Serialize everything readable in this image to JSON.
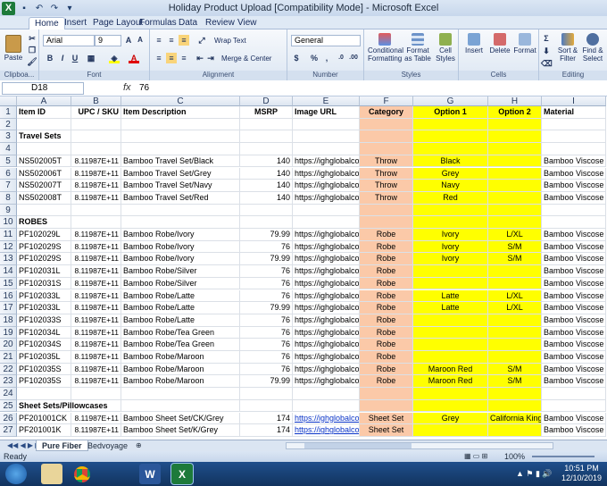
{
  "window": {
    "title": "Holiday Product Upload  [Compatibility Mode] - Microsoft Excel"
  },
  "tabs": [
    "Home",
    "Insert",
    "Page Layout",
    "Formulas",
    "Data",
    "Review",
    "View"
  ],
  "ribbon": {
    "paste": "Paste",
    "clipboard": "Clipboa...",
    "font_name": "Arial",
    "font_size": "9",
    "font_group": "Font",
    "wrap_text": "Wrap Text",
    "merge_center": "Merge & Center",
    "alignment_group": "Alignment",
    "number_format": "General",
    "number_group": "Number",
    "percent": "%",
    "comma": ",",
    "currency": "$",
    "cond_fmt": "Conditional Formatting",
    "fmt_table": "Format as Table",
    "cell_styles": "Cell Styles",
    "styles_group": "Styles",
    "insert": "Insert",
    "delete": "Delete",
    "format": "Format",
    "cells_group": "Cells",
    "sort_filter": "Sort & Filter",
    "find_select": "Find & Select",
    "editing_group": "Editing"
  },
  "formula_bar": {
    "name_box": "D18",
    "fx": "fx",
    "value": "76"
  },
  "columns": [
    "A",
    "B",
    "C",
    "D",
    "E",
    "F",
    "G",
    "H",
    "I"
  ],
  "rows": [
    {
      "n": "1",
      "A": "Item ID",
      "B": "UPC / SKU",
      "C": "Item Description",
      "D": "MSRP",
      "E": "Image URL",
      "F": "Category",
      "G": "Option 1",
      "H": "Option 2",
      "I": "Material",
      "hdr": true
    },
    {
      "n": "2"
    },
    {
      "n": "3",
      "A": "Travel Sets",
      "section": true
    },
    {
      "n": "4"
    },
    {
      "n": "5",
      "A": "NS502005T",
      "B": "8.11987E+11",
      "C": "Bamboo Travel Set/Black",
      "D": "140",
      "E": "https://ighglobalcorp.c",
      "F": "Throw",
      "G": "Black",
      "I": "Bamboo Viscose"
    },
    {
      "n": "6",
      "A": "NS502006T",
      "B": "8.11987E+11",
      "C": "Bamboo Travel Set/Grey",
      "D": "140",
      "E": "https://ighglobalcorp.c",
      "F": "Throw",
      "G": "Grey",
      "I": "Bamboo Viscose"
    },
    {
      "n": "7",
      "A": "NS502007T",
      "B": "8.11987E+11",
      "C": "Bamboo Travel Set/Navy",
      "D": "140",
      "E": "https://ighglobalcorp.c",
      "F": "Throw",
      "G": "Navy",
      "I": "Bamboo Viscose"
    },
    {
      "n": "8",
      "A": "NS502008T",
      "B": "8.11987E+11",
      "C": "Bamboo Travel Set/Red",
      "D": "140",
      "E": "https://ighglobalcorp.c",
      "F": "Throw",
      "G": "Red",
      "I": "Bamboo Viscose"
    },
    {
      "n": "9"
    },
    {
      "n": "10",
      "A": "ROBES",
      "section": true
    },
    {
      "n": "11",
      "A": "PF102029L",
      "B": "8.11987E+11",
      "C": "Bamboo Robe/Ivory",
      "D": "79.99",
      "E": "https://ighglobalcorp.c",
      "F": "Robe",
      "G": "Ivory",
      "H": "L/XL",
      "I": "Bamboo Viscose"
    },
    {
      "n": "12",
      "A": "PF102029S",
      "B": "8.11987E+11",
      "C": "Bamboo Robe/Ivory",
      "D": "76",
      "E": "https://ighglobalcorp.c",
      "F": "Robe",
      "G": "Ivory",
      "H": "S/M",
      "I": "Bamboo Viscose"
    },
    {
      "n": "13",
      "A": "PF102029S",
      "B": "8.11987E+11",
      "C": "Bamboo Robe/Ivory",
      "D": "79.99",
      "E": "https://ighglobalcorp.c",
      "F": "Robe",
      "G": "Ivory",
      "H": "S/M",
      "I": "Bamboo Viscose"
    },
    {
      "n": "14",
      "A": "PF102031L",
      "B": "8.11987E+11",
      "C": "Bamboo Robe/Silver",
      "D": "76",
      "E": "https://ighglobalcorp.c",
      "F": "Robe",
      "I": "Bamboo Viscose"
    },
    {
      "n": "15",
      "A": "PF102031S",
      "B": "8.11987E+11",
      "C": "Bamboo Robe/Silver",
      "D": "76",
      "E": "https://ighglobalcorp.c",
      "F": "Robe",
      "I": "Bamboo Viscose"
    },
    {
      "n": "16",
      "A": "PF102033L",
      "B": "8.11987E+11",
      "C": "Bamboo Robe/Latte",
      "D": "76",
      "E": "https://ighglobalcorp.c",
      "F": "Robe",
      "G": "Latte",
      "H": "L/XL",
      "I": "Bamboo Viscose"
    },
    {
      "n": "17",
      "A": "PF102033L",
      "B": "8.11987E+11",
      "C": "Bamboo Robe/Latte",
      "D": "79.99",
      "E": "https://ighglobalcorp.c",
      "F": "Robe",
      "G": "Latte",
      "H": "L/XL",
      "I": "Bamboo Viscose"
    },
    {
      "n": "18",
      "A": "PF102033S",
      "B": "8.11987E+11",
      "C": "Bamboo Robe/Latte",
      "D": "76",
      "E": "https://ighglobalcorp.c",
      "F": "Robe",
      "I": "Bamboo Viscose"
    },
    {
      "n": "19",
      "A": "PF102034L",
      "B": "8.11987E+11",
      "C": "Bamboo Robe/Tea Green",
      "D": "76",
      "E": "https://ighglobalcorp.c",
      "F": "Robe",
      "I": "Bamboo Viscose"
    },
    {
      "n": "20",
      "A": "PF102034S",
      "B": "8.11987E+11",
      "C": "Bamboo Robe/Tea Green",
      "D": "76",
      "E": "https://ighglobalcorp.c",
      "F": "Robe",
      "I": "Bamboo Viscose"
    },
    {
      "n": "21",
      "A": "PF102035L",
      "B": "8.11987E+11",
      "C": "Bamboo Robe/Maroon",
      "D": "76",
      "E": "https://ighglobalcorp.c",
      "F": "Robe",
      "I": "Bamboo Viscose"
    },
    {
      "n": "22",
      "A": "PF102035S",
      "B": "8.11987E+11",
      "C": "Bamboo Robe/Maroon",
      "D": "76",
      "E": "https://ighglobalcorp.c",
      "F": "Robe",
      "G": "Maroon Red",
      "H": "S/M",
      "I": "Bamboo Viscose"
    },
    {
      "n": "23",
      "A": "PF102035S",
      "B": "8.11987E+11",
      "C": "Bamboo Robe/Maroon",
      "D": "79.99",
      "E": "https://ighglobalcorp.c",
      "F": "Robe",
      "G": "Maroon Red",
      "H": "S/M",
      "I": "Bamboo Viscose"
    },
    {
      "n": "24"
    },
    {
      "n": "25",
      "A": "Sheet Sets/Pillowcases",
      "section": true
    },
    {
      "n": "26",
      "A": "PF201001CK",
      "B": "8.11987E+11",
      "C": "Bamboo Sheet Set/CK/Grey",
      "D": "174",
      "E": "https://ighglobalco",
      "F": "Sheet Set",
      "G": "Grey",
      "H": "California King",
      "I": "Bamboo Viscose",
      "link": true
    },
    {
      "n": "27",
      "A": "PF201001K",
      "B": "8.11987E+11",
      "C": "Bamboo Sheet Set/K/Grey",
      "D": "174",
      "E": "https://ighglobalco",
      "F": "Sheet Set",
      "I": "Bamboo Viscose",
      "link": true
    }
  ],
  "sheet_tabs": [
    "Pure Fiber",
    "Bedvoyage"
  ],
  "status": {
    "text": "Ready",
    "zoom": "100%"
  },
  "clock": {
    "time": "10:51 PM",
    "date": "12/10/2019"
  },
  "colors": {
    "category_fill": "#fbc9a8",
    "option_fill": "#ffff00"
  }
}
